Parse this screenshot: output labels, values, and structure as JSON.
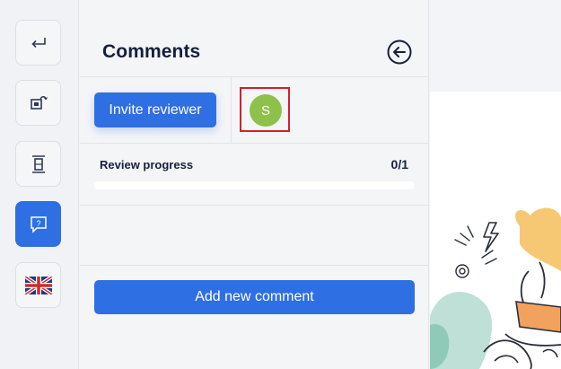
{
  "panel": {
    "title": "Comments",
    "invite_label": "Invite reviewer",
    "reviewer_initial": "S",
    "progress_label": "Review progress",
    "progress_count": "0/1",
    "progress_fraction": 0,
    "add_comment_label": "Add new comment"
  },
  "rail": {
    "items": [
      {
        "icon": "return-icon",
        "active": false
      },
      {
        "icon": "layout-swap-icon",
        "active": false
      },
      {
        "icon": "frame-icon",
        "active": false
      },
      {
        "icon": "help-chat-icon",
        "active": true
      },
      {
        "icon": "uk-flag-icon",
        "active": false
      }
    ]
  },
  "colors": {
    "accent": "#2f6fe4",
    "avatar": "#8dc14a",
    "highlight": "#d0212b"
  }
}
